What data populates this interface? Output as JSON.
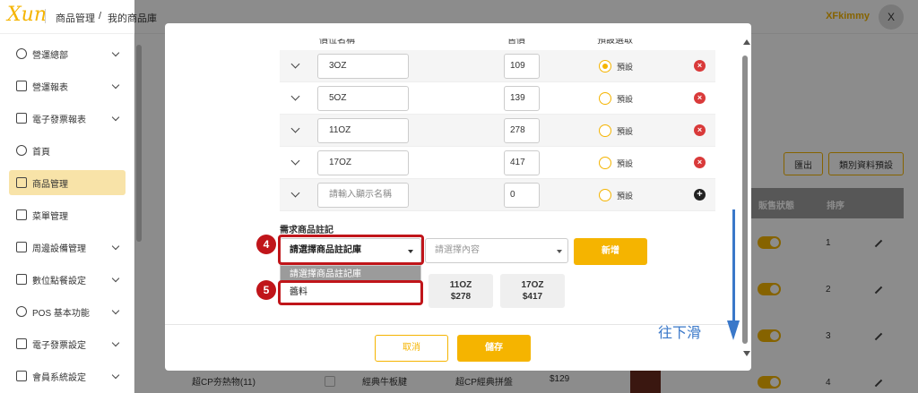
{
  "app": {
    "logo": "Xun",
    "breadcrumb": [
      "商品管理",
      "/",
      "我的商品庫"
    ],
    "user_name": "XFkimmy",
    "avatar_letter": "X"
  },
  "sidebar": {
    "items": [
      {
        "label": "營運總部",
        "icon": "target-icon",
        "active": false
      },
      {
        "label": "營運報表",
        "icon": "chart-icon",
        "active": false
      },
      {
        "label": "電子發票報表",
        "icon": "document-icon",
        "active": false
      },
      {
        "label": "首頁",
        "icon": "bell-icon",
        "active": false
      },
      {
        "label": "商品管理",
        "icon": "bag-icon",
        "active": true
      },
      {
        "label": "菜單管理",
        "icon": "grid-icon",
        "active": false
      },
      {
        "label": "周邊設備管理",
        "icon": "printer-icon",
        "active": false
      },
      {
        "label": "數位點餐設定",
        "icon": "edit-icon",
        "active": false
      },
      {
        "label": "POS 基本功能",
        "icon": "gear-icon",
        "active": false
      },
      {
        "label": "電子發票設定",
        "icon": "receipt-icon",
        "active": false
      },
      {
        "label": "會員系統設定",
        "icon": "id-card-icon",
        "active": false
      }
    ]
  },
  "background": {
    "export_button": "匯出",
    "category_default_button": "類別資料預設",
    "table_headers": [
      "販售狀態",
      "排序"
    ],
    "rows": [
      {
        "order": "1"
      },
      {
        "order": "2"
      },
      {
        "order": "3"
      },
      {
        "order": "4"
      }
    ],
    "bottom_row": {
      "category": "超CP夯熱物(11)",
      "item": "經典牛板腱",
      "set": "超CP經典拼盤",
      "price": "$129"
    }
  },
  "modal": {
    "spec_headers": {
      "name": "價位名稱",
      "price": "售價",
      "default": "預設選取"
    },
    "spec_rows": [
      {
        "name": "3OZ",
        "price": "109",
        "default_label": "預設",
        "selected": true,
        "action": "delete"
      },
      {
        "name": "5OZ",
        "price": "139",
        "default_label": "預設",
        "selected": false,
        "action": "delete"
      },
      {
        "name": "11OZ",
        "price": "278",
        "default_label": "預設",
        "selected": false,
        "action": "delete"
      },
      {
        "name": "17OZ",
        "price": "417",
        "default_label": "預設",
        "selected": false,
        "action": "delete"
      },
      {
        "name": "",
        "placeholder": "請輸入顯示名稱",
        "price": "0",
        "default_label": "預設",
        "selected": false,
        "action": "add"
      }
    ],
    "note": {
      "title": "需求商品註記",
      "library_select": "請選擇商品註記庫",
      "content_placeholder": "請選擇內容",
      "add_button": "新增",
      "dropdown_options": [
        "請選擇商品註記庫",
        "醬料"
      ]
    },
    "price_chips": [
      {
        "name": "11OZ",
        "price": "$278"
      },
      {
        "name": "17OZ",
        "price": "$417"
      }
    ],
    "cancel_button": "取消",
    "save_button": "儲存"
  },
  "annotations": {
    "step4": "4",
    "step5": "5",
    "scroll_hint": "往下滑",
    "highlight_color": "#c0151a",
    "arrow_color": "#3a78c9"
  },
  "colors": {
    "accent": "#f5b400",
    "delete": "#d93a3a"
  }
}
